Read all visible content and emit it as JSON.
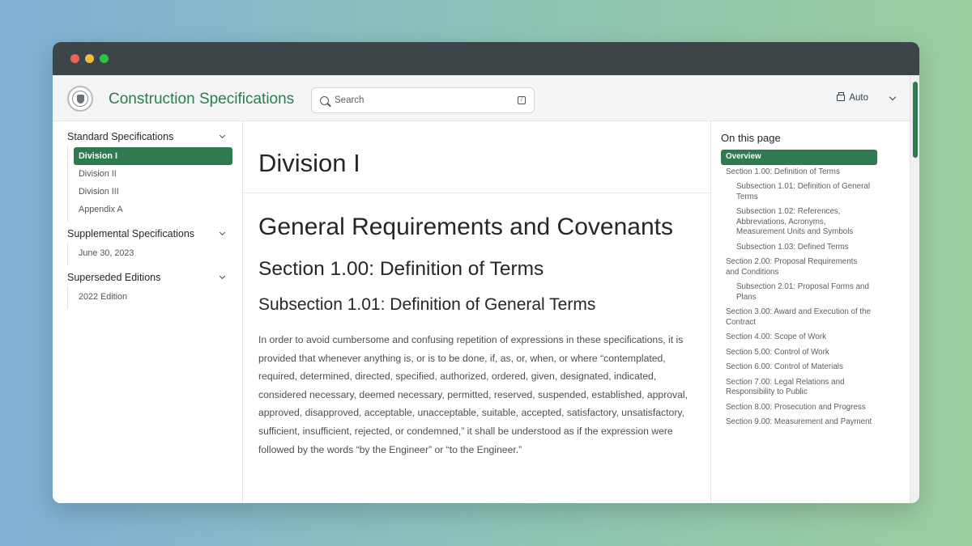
{
  "header": {
    "site_title": "Construction Specifications",
    "search_placeholder": "Search",
    "theme_label": "Auto"
  },
  "left_nav": {
    "groups": [
      {
        "title": "Standard Specifications",
        "items": [
          "Division I",
          "Division II",
          "Division III",
          "Appendix A"
        ]
      },
      {
        "title": "Supplemental Specifications",
        "items": [
          "June 30, 2023"
        ]
      },
      {
        "title": "Superseded Editions",
        "items": [
          "2022 Edition"
        ]
      }
    ]
  },
  "main": {
    "page_title": "Division I",
    "heading_general": "General Requirements and Covenants",
    "heading_section": "Section 1.00: Definition of Terms",
    "heading_subsection": "Subsection 1.01: Definition of General Terms",
    "paragraph": "In order to avoid cumbersome and confusing repetition of expressions in these specifications, it is provided that whenever anything is, or is to be done, if, as, or, when, or where “contemplated, required, determined, directed, specified, authorized, ordered, given, designated, indicated, considered necessary, deemed necessary, permitted, reserved, suspended, established, approval, approved, disapproved, acceptable, unacceptable, suitable, accepted, satisfactory, unsatisfactory, sufficient, insufficient, rejected, or condemned,” it shall be understood as if the expression were followed by the words “by the Engineer” or “to the Engineer.”"
  },
  "toc": {
    "title": "On this page",
    "items": [
      "Overview",
      "Section 1.00: Definition of Terms",
      "Subsection 1.01: Definition of General Terms",
      "Subsection 1.02: References, Abbreviations, Acronyms, Measurement Units and Symbols",
      "Subsection 1.03: Defined Terms",
      "Section 2.00: Proposal Requirements and Conditions",
      "Subsection 2.01: Proposal Forms and Plans",
      "Section 3.00: Award and Execution of the Contract",
      "Section 4.00: Scope of Work",
      "Section 5.00: Control of Work",
      "Section 6.00: Control of Materials",
      "Section 7.00: Legal Relations and Responsibility to Public",
      "Section 8.00: Prosecution and Progress",
      "Section 9.00: Measurement and Payment"
    ]
  },
  "colors": {
    "accent": "#2f7a4f",
    "titlebar": "#3c4649"
  }
}
